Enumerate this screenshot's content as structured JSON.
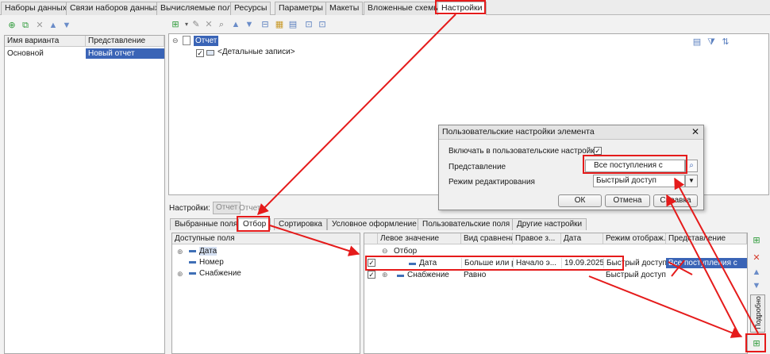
{
  "top_tabs": [
    "Наборы данных",
    "Связи наборов данных",
    "Вычисляемые поля",
    "Ресурсы",
    "Параметры",
    "Макеты",
    "Вложенные схемы",
    "Настройки"
  ],
  "variants": {
    "headers": [
      "Имя варианта",
      "Представление"
    ],
    "rows": [
      [
        "Основной",
        "Новый отчет"
      ]
    ]
  },
  "structure": {
    "root": "Отчет",
    "child": "<Детальные записи>"
  },
  "settings_row": {
    "label": "Настройки:",
    "btn_active": "Отчет",
    "btn_inactive": "Отчет"
  },
  "settings_tabs": [
    "Выбранные поля",
    "Отбор",
    "Сортировка",
    "Условное оформление",
    "Пользовательские поля",
    "Другие настройки"
  ],
  "available_fields": {
    "header": "Доступные поля",
    "items": [
      "Дата",
      "Номер",
      "Снабжение"
    ]
  },
  "filter_table": {
    "headers": [
      "Левое значение",
      "Вид сравнения",
      "Правое з...",
      "Дата",
      "Режим отображ...",
      "Представление"
    ],
    "group": "Отбор",
    "rows": [
      {
        "left": "Дата",
        "compare": "Больше или рав...",
        "right": "Начало э...",
        "date": "19.09.2025...",
        "mode": "Быстрый доступ",
        "repr": "Все поступления с"
      },
      {
        "left": "Снабжение",
        "compare": "Равно",
        "right": "",
        "date": "",
        "mode": "Быстрый доступ",
        "repr": ""
      }
    ]
  },
  "side_button": "Подробно",
  "dialog": {
    "title": "Пользовательские настройки элемента",
    "include_label": "Включать в пользовательские настройки",
    "repr_label": "Представление",
    "repr_value": "Все поступления с",
    "mode_label": "Режим редактирования",
    "mode_value": "Быстрый доступ",
    "ok": "ОК",
    "cancel": "Отмена",
    "help": "Справка"
  },
  "colors": {
    "accent": "#e51b1b",
    "selection": "#3a64b6"
  }
}
